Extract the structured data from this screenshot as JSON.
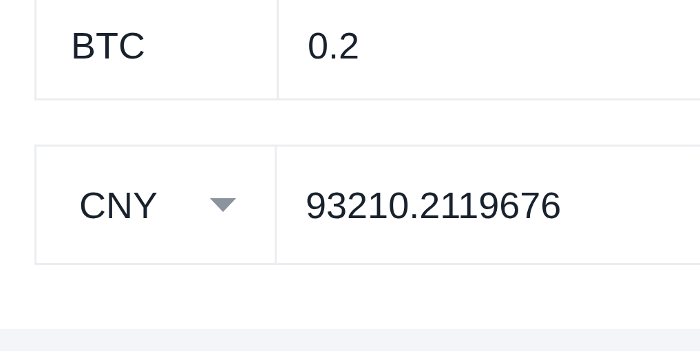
{
  "from": {
    "currency": "BTC",
    "amount": "0.2"
  },
  "to": {
    "currency": "CNY",
    "amount": "93210.2119676"
  }
}
